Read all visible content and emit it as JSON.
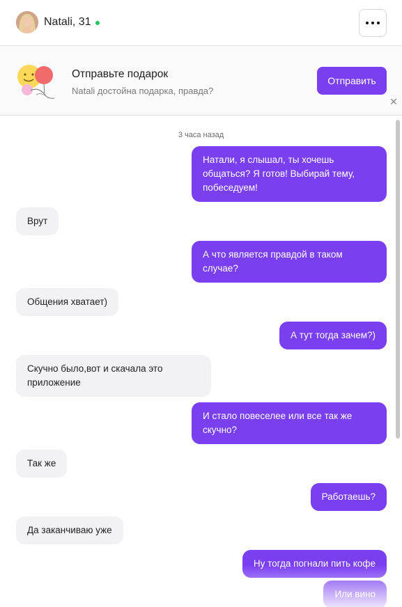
{
  "header": {
    "user_name": "Natali, 31",
    "more_icon": "more-dots-icon",
    "online_color": "#22c55e"
  },
  "gift_banner": {
    "title": "Отправьте подарок",
    "subtitle": "Natali достойна подарка, правда?",
    "button_label": "Отправить",
    "close_glyph": "✕",
    "accent": "#7b3ff2"
  },
  "chat": {
    "timestamp": "3 часа назад",
    "messages": [
      {
        "side": "out",
        "text": "Натали, я слышал, ты хочешь общаться? Я готов! Выбирай тему, побеседуем!"
      },
      {
        "side": "in",
        "text": "Врут"
      },
      {
        "side": "out",
        "text": "А что является правдой в таком случае?"
      },
      {
        "side": "in",
        "text": "Общения хватает)"
      },
      {
        "side": "out",
        "text": "А тут тогда зачем?)"
      },
      {
        "side": "in",
        "text": "Скучно было,вот и скачала это приложение"
      },
      {
        "side": "out",
        "text": "И стало повеселее или все так же скучно?"
      },
      {
        "side": "in",
        "text": "Так же"
      },
      {
        "side": "out",
        "text": "Работаешь?"
      },
      {
        "side": "in",
        "text": "Да заканчиваю уже"
      },
      {
        "side": "out",
        "text": "Ну тогда погнали пить кофе"
      },
      {
        "side": "out",
        "text": "Или вино"
      }
    ]
  }
}
